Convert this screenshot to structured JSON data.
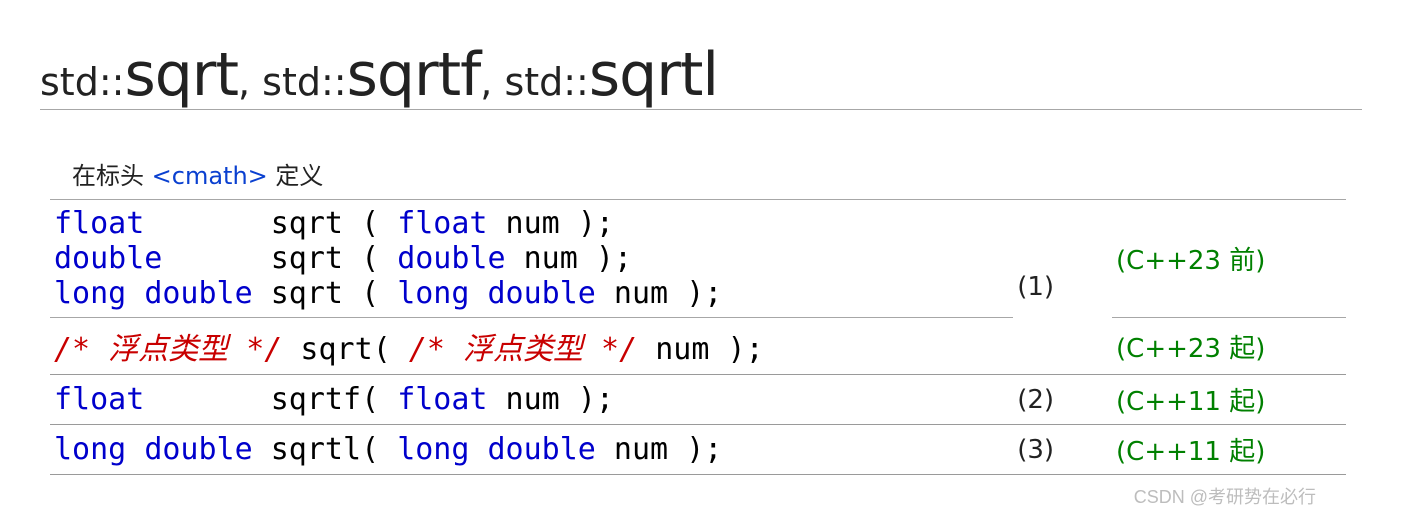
{
  "title": {
    "ns": "std::",
    "f1": "sqrt",
    "sep": ", ",
    "f2": "sqrtf",
    "f3": "sqrtl"
  },
  "header": {
    "pre": "在标头 ",
    "link": "<cmath>",
    "post": " 定义"
  },
  "rows": [
    {
      "code": [
        [
          {
            "t": "float",
            "c": "kw"
          },
          {
            "t": "       sqrt "
          },
          {
            "t": "(",
            "c": ""
          },
          {
            "t": " "
          },
          {
            "t": "float",
            "c": "kw"
          },
          {
            "t": " num "
          },
          {
            "t": ")",
            "c": ""
          },
          {
            "t": ";",
            "c": ""
          }
        ],
        [
          {
            "t": "double",
            "c": "kw"
          },
          {
            "t": "      sqrt "
          },
          {
            "t": "(",
            "c": ""
          },
          {
            "t": " "
          },
          {
            "t": "double",
            "c": "kw"
          },
          {
            "t": " num "
          },
          {
            "t": ")",
            "c": ""
          },
          {
            "t": ";",
            "c": ""
          }
        ],
        [
          {
            "t": "long",
            "c": "kw"
          },
          {
            "t": " "
          },
          {
            "t": "double",
            "c": "kw"
          },
          {
            "t": " sqrt "
          },
          {
            "t": "(",
            "c": ""
          },
          {
            "t": " "
          },
          {
            "t": "long",
            "c": "kw"
          },
          {
            "t": " "
          },
          {
            "t": "double",
            "c": "kw"
          },
          {
            "t": " num "
          },
          {
            "t": ")",
            "c": ""
          },
          {
            "t": ";",
            "c": ""
          }
        ]
      ],
      "num": "(1)",
      "num_rowspan": 2,
      "ver": "(C++23 前)",
      "topsep": false
    },
    {
      "code": [
        [
          {
            "t": "/* 浮点类型 */",
            "c": "cmt"
          },
          {
            "t": " sqrt"
          },
          {
            "t": "(",
            "c": ""
          },
          {
            "t": " "
          },
          {
            "t": "/* 浮点类型 */",
            "c": "cmt"
          },
          {
            "t": " num "
          },
          {
            "t": ")",
            "c": ""
          },
          {
            "t": ";",
            "c": ""
          }
        ]
      ],
      "num": null,
      "ver": "(C++23 起)",
      "topsep": true
    },
    {
      "code": [
        [
          {
            "t": "float",
            "c": "kw"
          },
          {
            "t": "       sqrtf"
          },
          {
            "t": "(",
            "c": ""
          },
          {
            "t": " "
          },
          {
            "t": "float",
            "c": "kw"
          },
          {
            "t": " num "
          },
          {
            "t": ")",
            "c": ""
          },
          {
            "t": ";",
            "c": ""
          }
        ]
      ],
      "num": "(2)",
      "ver": "(C++11 起)",
      "topsep": true,
      "strong": true
    },
    {
      "code": [
        [
          {
            "t": "long",
            "c": "kw"
          },
          {
            "t": " "
          },
          {
            "t": "double",
            "c": "kw"
          },
          {
            "t": " sqrtl"
          },
          {
            "t": "(",
            "c": ""
          },
          {
            "t": " "
          },
          {
            "t": "long",
            "c": "kw"
          },
          {
            "t": " "
          },
          {
            "t": "double",
            "c": "kw"
          },
          {
            "t": " num "
          },
          {
            "t": ")",
            "c": ""
          },
          {
            "t": ";",
            "c": ""
          }
        ]
      ],
      "num": "(3)",
      "ver": "(C++11 起)",
      "topsep": true,
      "strong": true,
      "bottomsep": true
    }
  ],
  "watermark": "CSDN @考研势在必行"
}
